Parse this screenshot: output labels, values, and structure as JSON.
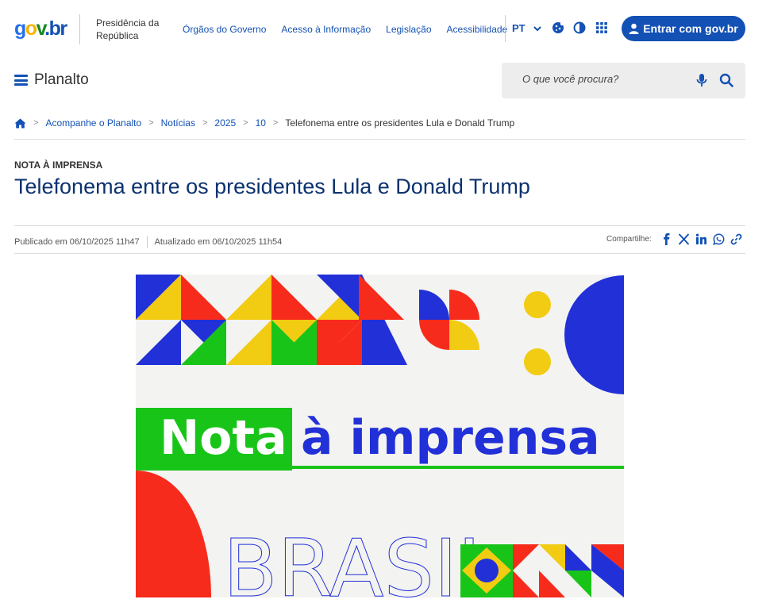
{
  "header": {
    "logo": {
      "g": "g",
      "o": "o",
      "v": "v",
      "dot": ".",
      "b": "b",
      "r": "r"
    },
    "org_name": "Presidência da República",
    "links": [
      "Órgãos do Governo",
      "Acesso à Informação",
      "Legislação",
      "Acessibilidade"
    ],
    "language": "PT",
    "login_label": "Entrar com gov.br"
  },
  "subheader": {
    "site_name": "Planalto",
    "search_placeholder": "O que você procura?"
  },
  "breadcrumb": {
    "items": [
      "Acompanhe o Planalto",
      "Notícias",
      "2025",
      "10"
    ],
    "current": "Telefonema entre os presidentes Lula e Donald Trump"
  },
  "article": {
    "kicker": "NOTA À IMPRENSA",
    "title": "Telefonema entre os presidentes Lula e Donald Trump",
    "published": "Publicado em 06/10/2025 11h47",
    "updated": "Atualizado em 06/10/2025 11h54",
    "share_label": "Compartilhe:",
    "share_icons": [
      "facebook-icon",
      "x-icon",
      "linkedin-icon",
      "whatsapp-icon",
      "link-icon"
    ]
  },
  "hero": {
    "word1": "Nota",
    "word2": "à imprensa",
    "bottom_text": "BRASIL"
  },
  "colors": {
    "blue": "#1351b4",
    "navy": "#0c326f",
    "green": "#19c419",
    "yellow": "#f2cb13",
    "red": "#f72b1c",
    "royal": "#2230d8"
  }
}
